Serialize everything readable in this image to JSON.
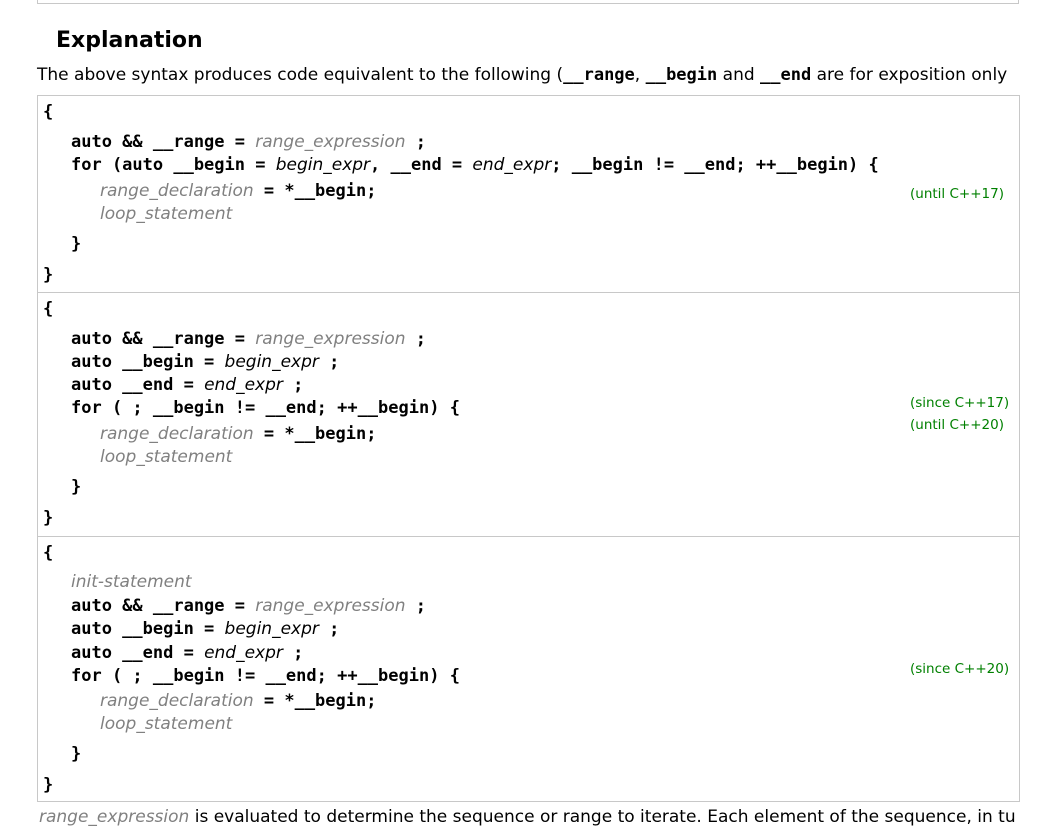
{
  "heading": "Explanation",
  "intro": {
    "before": "The above syntax produces code equivalent to the following (",
    "range": "__range",
    "comma": ", ",
    "begin": "__begin",
    "and": " and ",
    "end": "__end",
    "after": " are for exposition only"
  },
  "ph": {
    "range_expression": "range_expression",
    "begin_expr": "begin_expr",
    "end_expr": "end_expr",
    "range_declaration": "range_declaration",
    "loop_statement": "loop_statement",
    "init_statement": "init-statement"
  },
  "code": {
    "open_brace": "{",
    "close_brace": "}",
    "auto_range": "auto && __range = ",
    "semicolon": " ;",
    "for_auto_begin": "for (auto __begin = ",
    "comma_end": ", __end = ",
    "loop_cond_old": "; __begin != __end; ++__begin) {",
    "deref_begin": " = *__begin;",
    "auto_begin": "auto __begin = ",
    "auto_end": "auto __end = ",
    "for_empty": "for ( ; __begin != __end; ++__begin) {"
  },
  "markers": {
    "until17": "(until C++17)",
    "since17": "(since C++17)",
    "until20": "(until C++20)",
    "since20": "(since C++20)"
  },
  "bottom": {
    "term": "range_expression",
    "text": " is evaluated to determine the sequence or range to iterate. Each element of the sequence, in tu"
  }
}
